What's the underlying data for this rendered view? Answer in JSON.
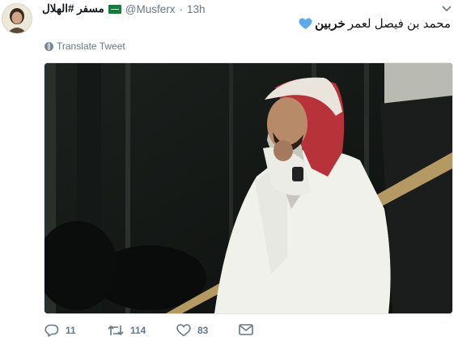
{
  "tweet": {
    "display_name": "مسفر #الهلال",
    "flag_icon": "saudi-flag-icon",
    "handle": "@Musferx",
    "separator": "·",
    "time": "13h",
    "text_regular": "محمد بن فيصل لعمر",
    "text_bold": "خربين",
    "heart_emoji": "💙",
    "translate_label": "Translate Tweet",
    "media_alt": "",
    "actions": {
      "reply_count": "11",
      "retweet_count": "114",
      "like_count": "83"
    }
  },
  "colors": {
    "text": "#14171a",
    "secondary": "#657786",
    "border": "#e1e8ed",
    "heart": "#5da9e9"
  }
}
